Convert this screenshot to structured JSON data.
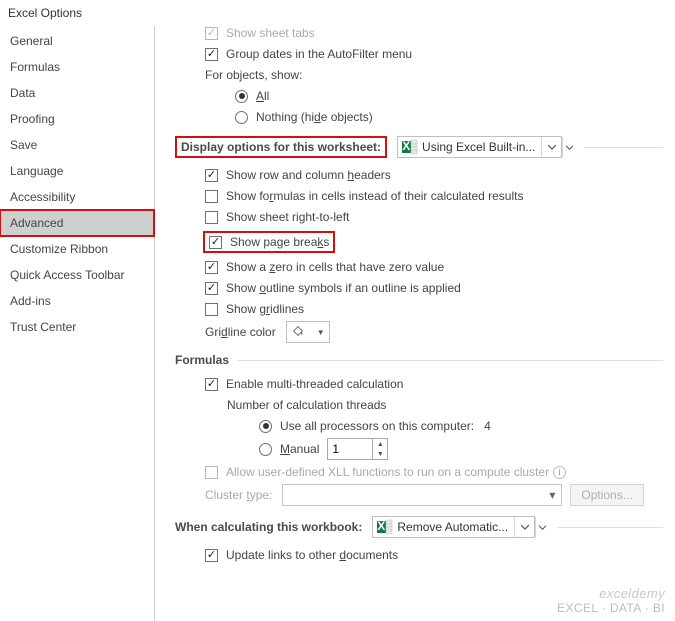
{
  "window": {
    "title": "Excel Options"
  },
  "sidebar": {
    "items": [
      {
        "label": "General"
      },
      {
        "label": "Formulas"
      },
      {
        "label": "Data"
      },
      {
        "label": "Proofing"
      },
      {
        "label": "Save"
      },
      {
        "label": "Language"
      },
      {
        "label": "Accessibility"
      },
      {
        "label": "Advanced"
      },
      {
        "label": "Customize Ribbon"
      },
      {
        "label": "Quick Access Toolbar"
      },
      {
        "label": "Add-ins"
      },
      {
        "label": "Trust Center"
      }
    ]
  },
  "top": {
    "show_sheet_tabs": "Show sheet tabs",
    "group_dates": "Group dates in the AutoFilter menu",
    "for_objects": "For objects, show:",
    "all": "All",
    "nothing": "Nothing (hide objects)"
  },
  "ws_section": {
    "title": "Display options for this worksheet:",
    "dd_text": "Using Excel Built-in...",
    "row_col_headers": "Show row and column headers",
    "show_formulas": "Show formulas in cells instead of their calculated results",
    "right_to_left": "Show sheet right-to-left",
    "page_breaks": "Show page breaks",
    "zero_values": "Show a zero in cells that have zero value",
    "outline": "Show outline symbols if an outline is applied",
    "gridlines": "Show gridlines",
    "gridline_color": "Gridline color"
  },
  "formulas": {
    "title": "Formulas",
    "multi_thread": "Enable multi-threaded calculation",
    "num_threads": "Number of calculation threads",
    "use_all": "Use all processors on this computer:",
    "processor_count": "4",
    "manual": "Manual",
    "manual_value": "1",
    "xll": "Allow user-defined XLL functions to run on a compute cluster",
    "cluster_type": "Cluster type:",
    "options_btn": "Options..."
  },
  "calc_section": {
    "title": "When calculating this workbook:",
    "dd_text": "Remove Automatic...",
    "update_links": "Update links to other documents"
  },
  "watermark": {
    "brand": "exceldemy",
    "tag": "EXCEL · DATA · BI"
  }
}
